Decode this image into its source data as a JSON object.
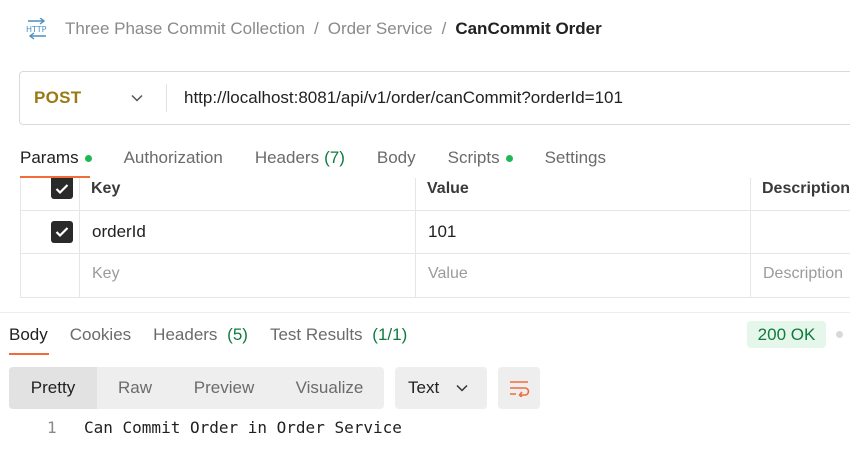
{
  "request": {
    "icon": "http-icon",
    "breadcrumb": {
      "collection": "Three Phase Commit Collection",
      "folder": "Order Service",
      "separator": "/",
      "current": "CanCommit Order"
    },
    "method": "POST",
    "url": "http://localhost:8081/api/v1/order/canCommit?orderId=101",
    "tabs": [
      {
        "label": "Params",
        "dot": true,
        "active": true
      },
      {
        "label": "Authorization"
      },
      {
        "label": "Headers",
        "count": "(7)"
      },
      {
        "label": "Body"
      },
      {
        "label": "Scripts",
        "dot": true
      },
      {
        "label": "Settings"
      }
    ]
  },
  "params_table": {
    "headers": {
      "key": "Key",
      "value": "Value",
      "description": "Description"
    },
    "rows": [
      {
        "checked": true,
        "key": "orderId",
        "value": "101",
        "description": ""
      }
    ],
    "placeholder": {
      "key": "Key",
      "value": "Value",
      "description": "Description"
    }
  },
  "response": {
    "tabs": [
      {
        "label": "Body",
        "active": true
      },
      {
        "label": "Cookies"
      },
      {
        "label": "Headers",
        "count": "(5)"
      },
      {
        "label": "Test Results",
        "count": "(1/1)"
      }
    ],
    "status": "200 OK",
    "format_tabs": [
      "Pretty",
      "Raw",
      "Preview",
      "Visualize"
    ],
    "format_selected": "Text",
    "body_lines": [
      {
        "number": "1",
        "text": "Can Commit Order in Order Service"
      }
    ]
  },
  "colors": {
    "accent": "#f26b3a",
    "method_post": "#9a7a12",
    "success": "#0f7b3f",
    "dot_green": "#1db954"
  }
}
